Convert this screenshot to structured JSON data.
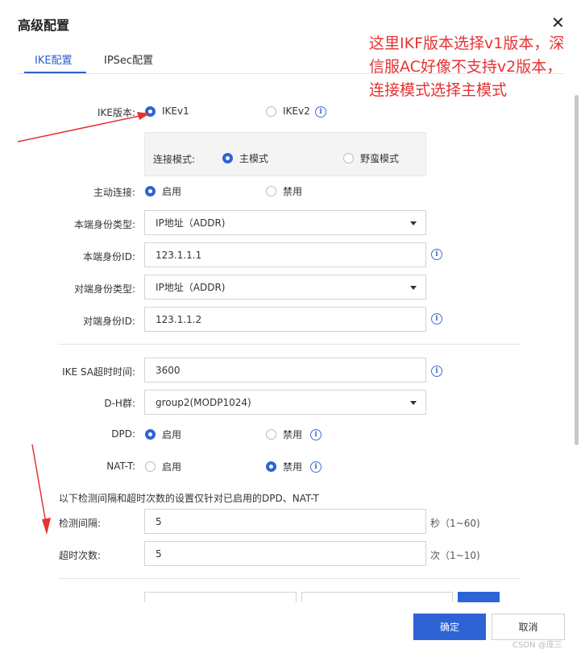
{
  "dialog": {
    "title": "高级配置",
    "close_glyph": "✕"
  },
  "tabs": [
    {
      "label": "IKE配置",
      "active": true
    },
    {
      "label": "IPSec配置",
      "active": false
    }
  ],
  "annotation": "这里IKF版本选择v1版本，深信服AC好像不支持v2版本，连接模式选择主模式",
  "form": {
    "ike_version": {
      "label": "IKE版本:",
      "opt1": "IKEv1",
      "opt2": "IKEv2",
      "selected": "IKEv1"
    },
    "conn_mode": {
      "label": "连接模式:",
      "opt1": "主模式",
      "opt2": "野蛮模式",
      "selected": "主模式"
    },
    "active_conn": {
      "label": "主动连接:",
      "opt1": "启用",
      "opt2": "禁用",
      "selected": "启用"
    },
    "local_id_type": {
      "label": "本端身份类型:",
      "value": "IP地址（ADDR)"
    },
    "local_id": {
      "label": "本端身份ID:",
      "value": "123.1.1.1"
    },
    "peer_id_type": {
      "label": "对端身份类型:",
      "value": "IP地址（ADDR)"
    },
    "peer_id": {
      "label": "对端身份ID:",
      "value": "123.1.1.2"
    },
    "sa_timeout": {
      "label": "IKE SA超时时间:",
      "value": "3600"
    },
    "dh_group": {
      "label": "D-H群:",
      "value": "group2(MODP1024)"
    },
    "dpd": {
      "label": "DPD:",
      "opt1": "启用",
      "opt2": "禁用",
      "selected": "启用"
    },
    "nat_t": {
      "label": "NAT-T:",
      "opt1": "启用",
      "opt2": "禁用",
      "selected": "禁用"
    },
    "note": "以下检测间隔和超时次数的设置仅针对已启用的DPD、NAT-T",
    "interval": {
      "label": "检测间隔:",
      "value": "5",
      "suffix": "秒（1~60)"
    },
    "timeout_count": {
      "label": "超时次数:",
      "value": "5",
      "suffix": "次（1~10)"
    }
  },
  "buttons": {
    "ok": "确定",
    "cancel": "取消"
  },
  "watermark": "CSDN @庞三",
  "colors": {
    "accent": "#2d63d5",
    "annotation": "#e53333"
  }
}
